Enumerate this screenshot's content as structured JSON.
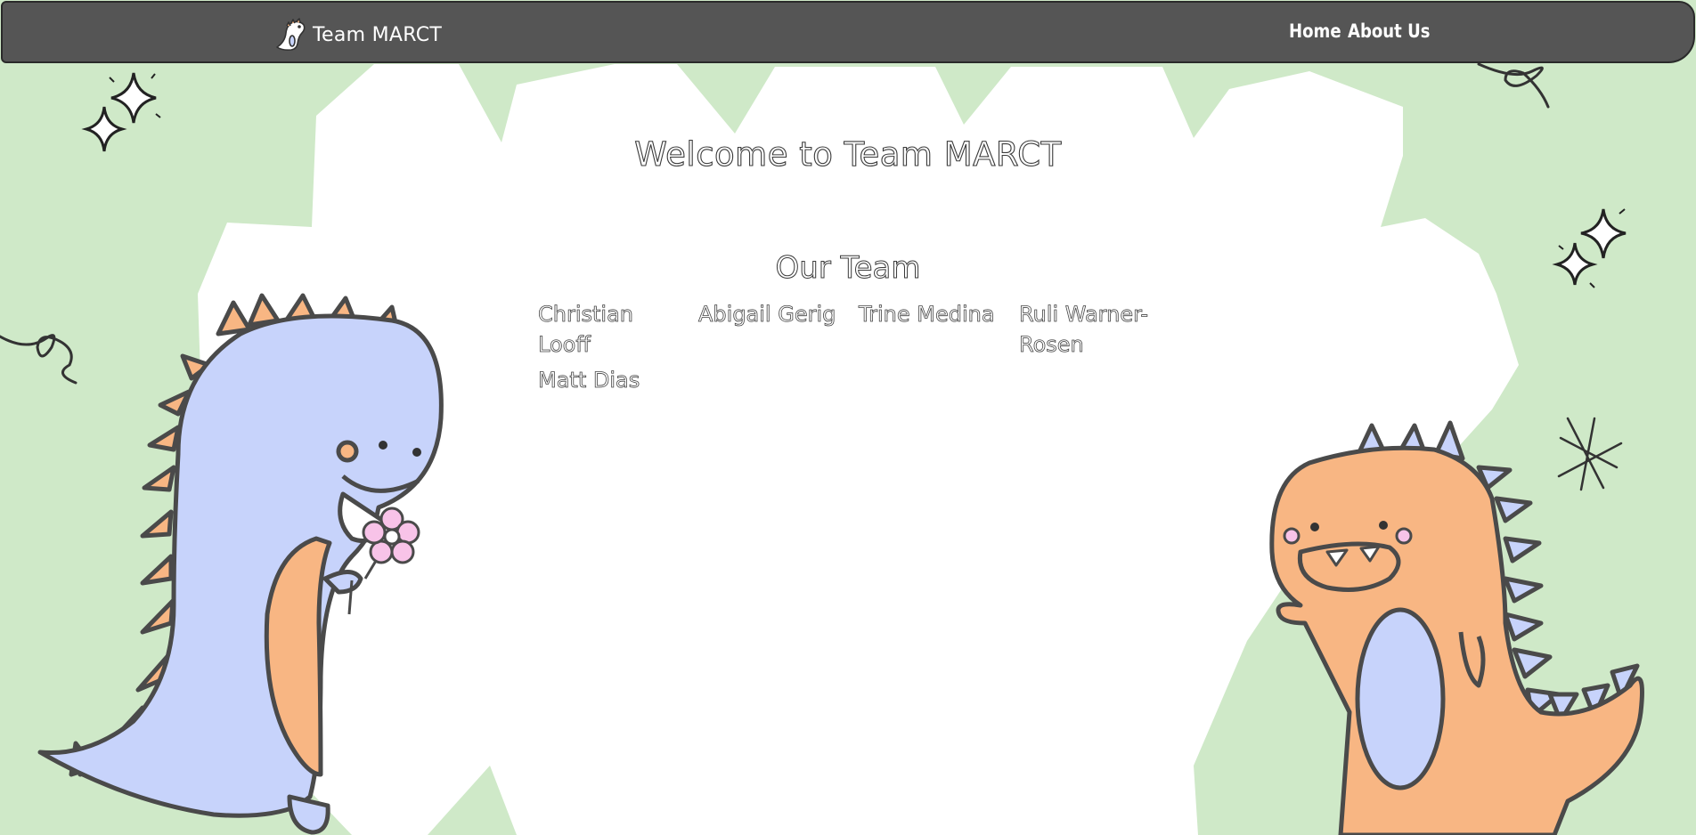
{
  "navbar": {
    "brand_name": "Team MARCT",
    "brand_logo_icon": "dino-logo-icon",
    "links": [
      {
        "label": "Home"
      },
      {
        "label": "About Us"
      }
    ]
  },
  "main": {
    "welcome_heading": "Welcome to Team MARCT",
    "team_heading": "Our Team",
    "members": [
      {
        "name": "Christian Looff"
      },
      {
        "name": "Abigail Gerig"
      },
      {
        "name": "Trine Medina"
      },
      {
        "name": "Ruli Warner-Rosen"
      },
      {
        "name": "Matt Dias"
      }
    ]
  },
  "decorations": {
    "left_character": "blue-dinosaur-with-flower",
    "right_character": "orange-dinosaur-waving",
    "icons": [
      "sparkle-icon",
      "swirl-icon",
      "asterisk-icon"
    ]
  },
  "colors": {
    "background_green": "#cfe9c8",
    "cloud_white": "#ffffff",
    "navbar_gray": "#555555",
    "dino_blue": "#c7d3fb",
    "dino_orange": "#f8b683",
    "outline": "#4a4a4a",
    "flower_pink": "#f8c3e8"
  }
}
